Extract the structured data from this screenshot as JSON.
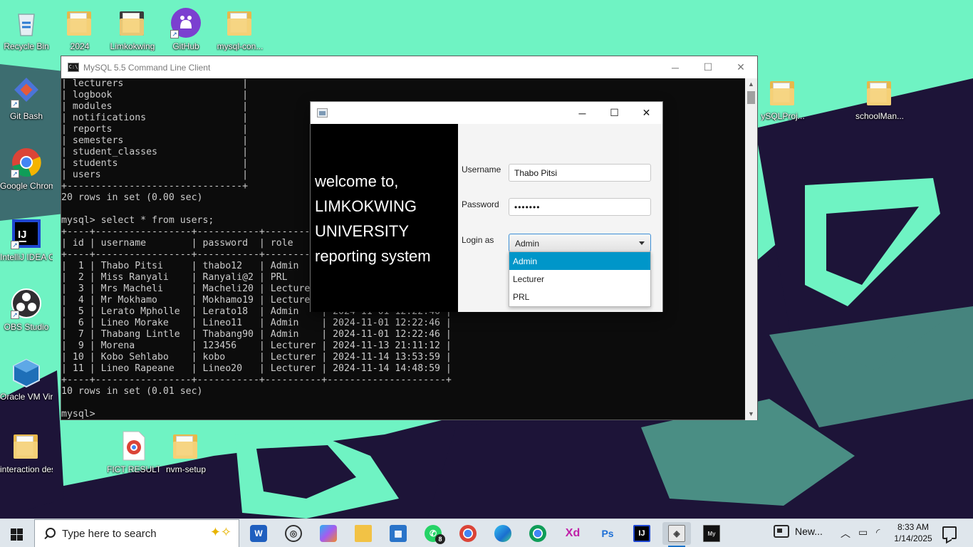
{
  "desktop": {
    "icons": [
      {
        "label": "Recycle Bin"
      },
      {
        "label": "2024"
      },
      {
        "label": "Limkokwing"
      },
      {
        "label": "GitHub"
      },
      {
        "label": "mysql-con..."
      },
      {
        "label": "Git Bash"
      },
      {
        "label": "Google Chrome"
      },
      {
        "label": "IntelliJ IDEA Communi..."
      },
      {
        "label": "OBS Studio"
      },
      {
        "label": "Oracle VM VirtualBox"
      },
      {
        "label": "interaction design"
      },
      {
        "label": "FICT RESULTS"
      },
      {
        "label": "nvm-setup"
      },
      {
        "label": "ySQLProj..."
      },
      {
        "label": "schoolMan..."
      }
    ]
  },
  "console": {
    "title": "MySQL 5.5 Command Line Client",
    "lines": [
      "| lecturers                     |",
      "| logbook                       |",
      "| modules                       |",
      "| notifications                 |",
      "| reports                       |",
      "| semesters                     |",
      "| student_classes               |",
      "| students                      |",
      "| users                         |",
      "+-------------------------------+",
      "20 rows in set (0.00 sec)",
      "",
      "mysql> select * from users;",
      "+----+-----------------+-----------+----------+---------------------+",
      "| id | username        | password  | role     |",
      "+----+-----------------+-----------+----------+---------------------+",
      "|  1 | Thabo Pitsi     | thabo12   | Admin    |",
      "|  2 | Miss Ranyali    | Ranyali@2 | PRL      |",
      "|  3 | Mrs Macheli     | Macheli20 | Lecturer |",
      "|  4 | Mr Mokhamo      | Mokhamo19 | Lecturer |",
      "|  5 | Lerato Mpholle  | Lerato18  | Admin    | 2024-11-01 12:22:46 |",
      "|  6 | Lineo Morake    | Lineo11   | Admin    | 2024-11-01 12:22:46 |",
      "|  7 | Thabang Lintle  | Thabang90 | Admin    | 2024-11-01 12:22:46 |",
      "|  9 | Morena          | 123456    | Lecturer | 2024-11-13 21:11:12 |",
      "| 10 | Kobo Sehlabo    | kobo      | Lecturer | 2024-11-14 13:53:59 |",
      "| 11 | Lineo Rapeane   | Lineo20   | Lecturer | 2024-11-14 14:48:59 |",
      "+----+-----------------+-----------+----------+---------------------+",
      "10 rows in set (0.01 sec)",
      "",
      "mysql>"
    ]
  },
  "login": {
    "welcome_lines": [
      "welcome to,",
      "LIMKOKWING",
      "UNIVERSITY",
      "reporting system"
    ],
    "username_label": "Username",
    "username_value": "Thabo Pitsi",
    "password_label": "Password",
    "password_mask": "•••••••",
    "login_as_label": "Login as",
    "role_selected": "Admin",
    "role_options": [
      "Admin",
      "Lecturer",
      "PRL"
    ]
  },
  "taskbar": {
    "search_placeholder": "Type here to search",
    "whatsapp_badge": "8",
    "news_label": "New...",
    "time": "8:33 AM",
    "date": "1/14/2025"
  },
  "colors": {
    "wallpaper_mint": "#6ff3c3",
    "wallpaper_dark": "#1d1438",
    "combo_highlight": "#0096c9"
  }
}
